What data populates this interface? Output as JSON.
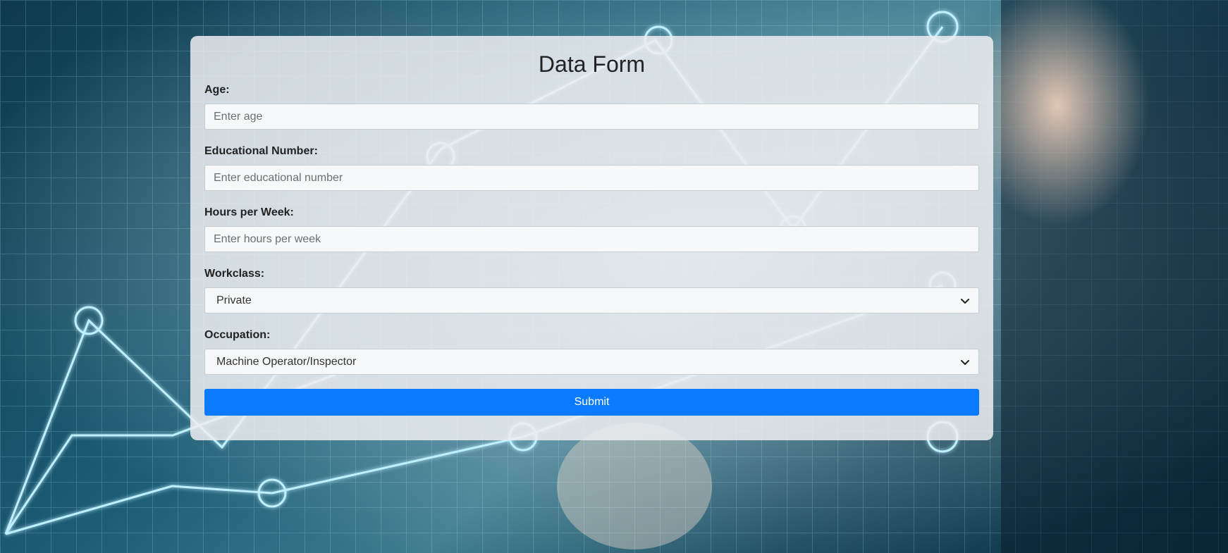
{
  "form": {
    "title": "Data Form",
    "fields": {
      "age": {
        "label": "Age:",
        "placeholder": "Enter age",
        "value": ""
      },
      "educational_number": {
        "label": "Educational Number:",
        "placeholder": "Enter educational number",
        "value": ""
      },
      "hours_per_week": {
        "label": "Hours per Week:",
        "placeholder": "Enter hours per week",
        "value": ""
      },
      "workclass": {
        "label": "Workclass:",
        "selected": "Private"
      },
      "occupation": {
        "label": "Occupation:",
        "selected": "Machine Operator/Inspector"
      }
    },
    "submit_label": "Submit"
  },
  "colors": {
    "accent": "#0a7bff",
    "card_background": "#eceef0",
    "background_dark": "#0e3a4c",
    "glow_line": "#bff0ff"
  },
  "icons": {
    "select_indicator": "chevron-down-icon"
  }
}
